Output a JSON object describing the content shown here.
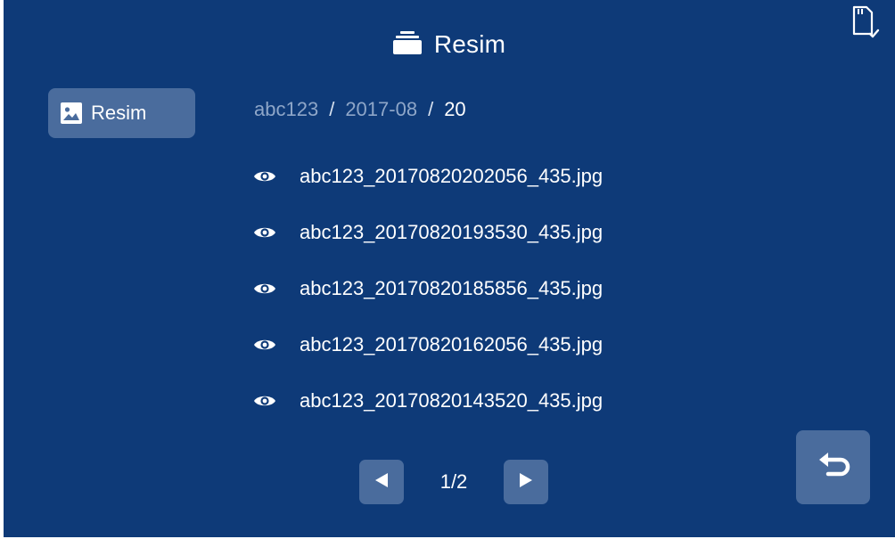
{
  "header": {
    "title": "Resim",
    "icon": "folder-stack-icon"
  },
  "status": {
    "sd_card_icon": "sd-card-check-icon"
  },
  "sidebar": {
    "items": [
      {
        "label": "Resim",
        "icon": "image-icon",
        "selected": true
      }
    ]
  },
  "breadcrumb": {
    "parts": [
      "abc123",
      "2017-08",
      "20"
    ],
    "separator": "/"
  },
  "files": [
    {
      "name": "abc123_20170820202056_435.jpg",
      "icon": "eye-icon"
    },
    {
      "name": "abc123_20170820193530_435.jpg",
      "icon": "eye-icon"
    },
    {
      "name": "abc123_20170820185856_435.jpg",
      "icon": "eye-icon"
    },
    {
      "name": "abc123_20170820162056_435.jpg",
      "icon": "eye-icon"
    },
    {
      "name": "abc123_20170820143520_435.jpg",
      "icon": "eye-icon"
    }
  ],
  "pagination": {
    "text": "1/2",
    "prev_icon": "triangle-left-icon",
    "next_icon": "triangle-right-icon"
  },
  "back_button": {
    "icon": "return-arrow-icon"
  },
  "colors": {
    "background": "#0e3a78",
    "button": "#4a6c9d",
    "text": "#ffffff",
    "dim_text": "#8ea6c8"
  }
}
